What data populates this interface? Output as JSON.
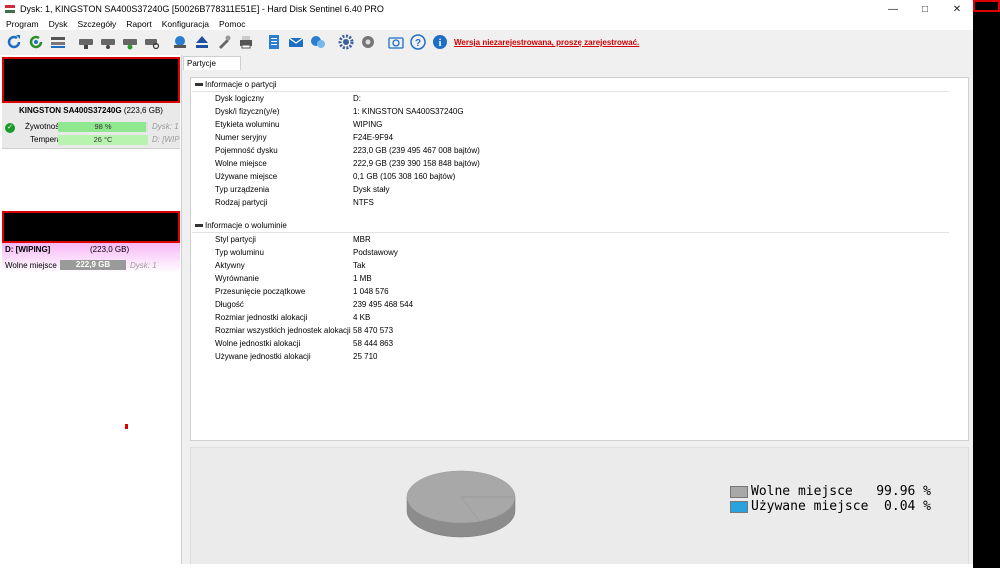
{
  "window": {
    "title": "Dysk: 1, KINGSTON SA400S37240G [50026B778311E51E]  -  Hard Disk Sentinel 6.40 PRO",
    "minimize": "—",
    "maximize": "□",
    "close": "✕"
  },
  "menu": [
    "Program",
    "Dysk",
    "Szczegóły",
    "Raport",
    "Konfiguracja",
    "Pomoc"
  ],
  "toolbar": {
    "unregistered_link": "Wersja niezarejestrowana, proszę zarejestrować."
  },
  "disk": {
    "name": "KINGSTON SA400S37240G",
    "capacity": "(223,6 GB)",
    "health_label": "Żywotność:",
    "health_value": "98 %",
    "health_percent": 98,
    "health_disk": "Dysk: 1",
    "temp_label": "Temperatura:",
    "temp_value": "26 °C",
    "temp_disk": "D: [WIP"
  },
  "partition": {
    "name": "D: [WIPING]",
    "capacity": "(223,0 GB)",
    "free_label": "Wolne miejsce",
    "free_value": "222,9 GB",
    "disk": "Dysk: 1"
  },
  "tabs": {
    "partitions": "Partycje"
  },
  "partition_info": {
    "heading": "Informacje o partycji",
    "rows": [
      {
        "label": "Dysk logiczny",
        "value": "D:"
      },
      {
        "label": "Dysk/i fizyczn(y/e)",
        "value": "1: KINGSTON SA400S37240G"
      },
      {
        "label": "Etykieta woluminu",
        "value": "WIPING"
      },
      {
        "label": "Numer seryjny",
        "value": "F24E-9F94"
      },
      {
        "label": "Pojemność dysku",
        "value": "223,0 GB (239 495 467 008 bajtów)"
      },
      {
        "label": "Wolne miejsce",
        "value": "222,9 GB (239 390 158 848 bajtów)"
      },
      {
        "label": "Używane miejsce",
        "value": "0,1 GB (105 308 160 bajtów)"
      },
      {
        "label": "Typ urządzenia",
        "value": "Dysk stały"
      },
      {
        "label": "Rodzaj partycji",
        "value": "NTFS"
      }
    ]
  },
  "volume_info": {
    "heading": "Informacje o woluminie",
    "rows": [
      {
        "label": "Styl partycji",
        "value": "MBR"
      },
      {
        "label": "Typ woluminu",
        "value": "Podstawowy"
      },
      {
        "label": "Aktywny",
        "value": "Tak"
      },
      {
        "label": "Wyrównanie",
        "value": "1 MB"
      },
      {
        "label": "Przesunięcie początkowe",
        "value": "1 048 576"
      },
      {
        "label": "Długość",
        "value": "239 495 468 544"
      },
      {
        "label": "Rozmiar jednostki alokacji",
        "value": "4 KB"
      },
      {
        "label": "Rozmiar wszystkich jednostek alokacji",
        "value": "58 470 573"
      },
      {
        "label": "Wolne jednostki alokacji",
        "value": "58 444 863"
      },
      {
        "label": "Używane jednostki alokacji",
        "value": "25 710"
      }
    ]
  },
  "chart_data": {
    "type": "pie",
    "categories": [
      "Wolne miejsce",
      "Używane miejsce"
    ],
    "values": [
      99.96,
      0.04
    ],
    "labels": [
      "Wolne miejsce   99.96 %",
      "Używane miejsce  0.04 %"
    ],
    "colors": [
      "#a8a8a8",
      "#29a3e0"
    ]
  }
}
